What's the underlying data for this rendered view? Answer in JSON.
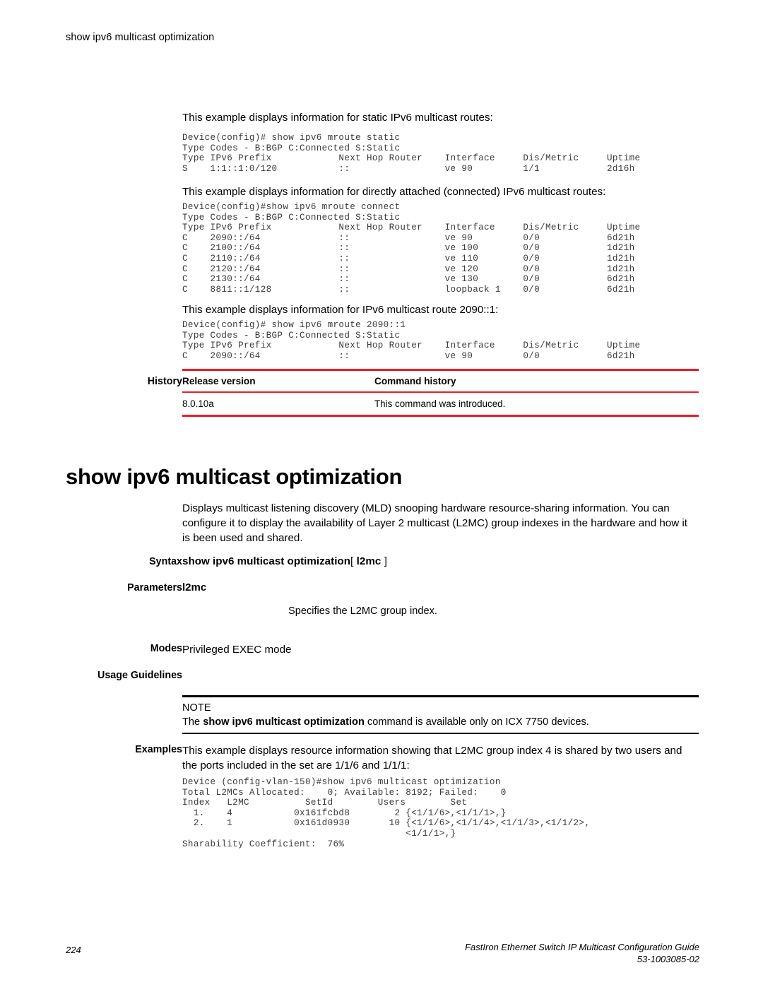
{
  "running_header": "show ipv6 multicast optimization",
  "examples_above": [
    {
      "intro": "This example displays information for static IPv6 multicast routes:",
      "code": "Device(config)# show ipv6 mroute static\nType Codes - B:BGP C:Connected S:Static\nType IPv6 Prefix            Next Hop Router    Interface     Dis/Metric     Uptime\nS    1:1::1:0/120           ::                 ve 90         1/1            2d16h"
    },
    {
      "intro": "This example displays information for directly attached (connected) IPv6 multicast routes:",
      "code": "Device(config)#show ipv6 mroute connect\nType Codes - B:BGP C:Connected S:Static\nType IPv6 Prefix            Next Hop Router    Interface     Dis/Metric     Uptime\nC    2090::/64              ::                 ve 90         0/0            6d21h\nC    2100::/64              ::                 ve 100        0/0            1d21h\nC    2110::/64              ::                 ve 110        0/0            1d21h\nC    2120::/64              ::                 ve 120        0/0            1d21h\nC    2130::/64              ::                 ve 130        0/0            6d21h\nC    8811::1/128            ::                 loopback 1    0/0            6d21h"
    },
    {
      "intro": "This example displays information for IPv6 multicast route 2090::1:",
      "code": "Device(config)# show ipv6 mroute 2090::1\nType Codes - B:BGP C:Connected S:Static\nType IPv6 Prefix            Next Hop Router    Interface     Dis/Metric     Uptime\nC    2090::/64              ::                 ve 90         0/0            6d21h"
    }
  ],
  "history": {
    "label": "History",
    "columns": [
      "Release version",
      "Command history"
    ],
    "rows": [
      {
        "release": "8.0.10a",
        "history": "This command was introduced."
      }
    ],
    "rule_color": "#ee1c25"
  },
  "section": {
    "heading": "show ipv6 multicast optimization",
    "description": "Displays multicast listening discovery (MLD) snooping hardware resource-sharing information. You can configure it to display the availability of Layer 2 multicast (L2MC) group indexes in the hardware and how it is been used and shared.",
    "syntax": {
      "label": "Syntax",
      "command": "show ipv6 multicast optimization",
      "optional_open": "[",
      "optional_param": "l2mc",
      "optional_close": "]"
    },
    "parameters": {
      "label": "Parameters",
      "name": "l2mc",
      "description": "Specifies the L2MC group index."
    },
    "modes": {
      "label": "Modes",
      "value": "Privileged EXEC mode"
    },
    "usage_guidelines": {
      "label": "Usage Guidelines"
    },
    "note": {
      "title": "NOTE",
      "prefix": "The ",
      "bold": "show ipv6 multicast optimization",
      "suffix": " command is available only on ICX 7750 devices."
    },
    "examples": {
      "label": "Examples",
      "intro": "This example displays resource information showing that L2MC group index 4 is shared by two users and the ports included in the set are 1/1/6 and 1/1/1:",
      "code": "Device (config-vlan-150)#show ipv6 multicast optimization\nTotal L2MCs Allocated:    0; Available: 8192; Failed:    0\nIndex   L2MC          SetId        Users        Set\n  1.    4           0x161fcbd8        2 {<1/1/6>,<1/1/1>,}\n  2.    1           0x161d0930       10 {<1/1/6>,<1/1/4>,<1/1/3>,<1/1/2>,\n                                        <1/1/1>,}\nSharability Coefficient:  76%"
    }
  },
  "footer": {
    "page_number": "224",
    "guide_title": "FastIron Ethernet Switch IP Multicast Configuration Guide",
    "doc_number": "53-1003085-02"
  }
}
